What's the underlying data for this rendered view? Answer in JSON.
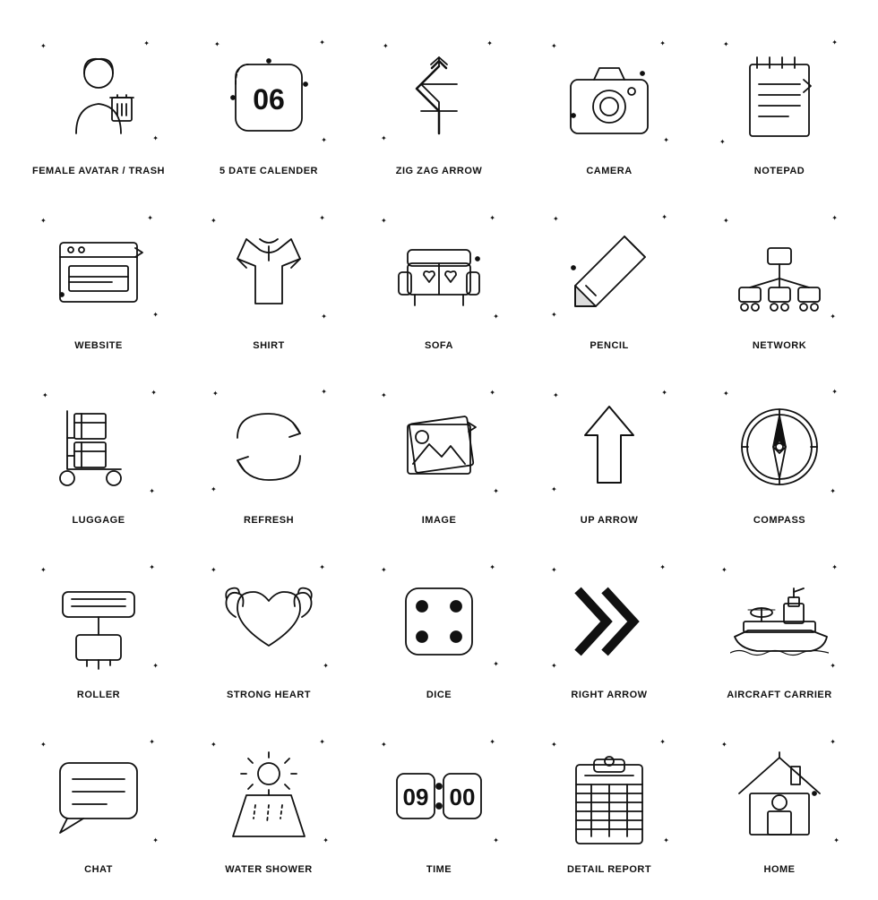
{
  "icons": [
    {
      "id": "female-avatar-trash",
      "label": "FEMALE AVATAR / TRASH"
    },
    {
      "id": "5-date-calendar",
      "label": "5 DATE CALENDER"
    },
    {
      "id": "zig-zag-arrow",
      "label": "ZIG ZAG ARROW"
    },
    {
      "id": "camera",
      "label": "CAMERA"
    },
    {
      "id": "notepad",
      "label": "NOTEPAD"
    },
    {
      "id": "website",
      "label": "WEBSITE"
    },
    {
      "id": "shirt",
      "label": "SHIRT"
    },
    {
      "id": "sofa",
      "label": "SOFA"
    },
    {
      "id": "pencil",
      "label": "PENCIL"
    },
    {
      "id": "network",
      "label": "NETWORK"
    },
    {
      "id": "luggage",
      "label": "LUGGAGE"
    },
    {
      "id": "refresh",
      "label": "REFRESH"
    },
    {
      "id": "image",
      "label": "IMAGE"
    },
    {
      "id": "up-arrow",
      "label": "UP ARROW"
    },
    {
      "id": "compass",
      "label": "COMPASS"
    },
    {
      "id": "roller",
      "label": "ROLLER"
    },
    {
      "id": "strong-heart",
      "label": "STRONG HEART"
    },
    {
      "id": "dice",
      "label": "DICE"
    },
    {
      "id": "right-arrow",
      "label": "RIGHT ARROW"
    },
    {
      "id": "aircraft-carrier",
      "label": "AIRCRAFT CARRIER"
    },
    {
      "id": "chat",
      "label": "CHAT"
    },
    {
      "id": "water-shower",
      "label": "WATER SHOWER"
    },
    {
      "id": "time",
      "label": "TIME"
    },
    {
      "id": "detail-report",
      "label": "DETAIL REPORT"
    },
    {
      "id": "home",
      "label": "HOME"
    }
  ]
}
